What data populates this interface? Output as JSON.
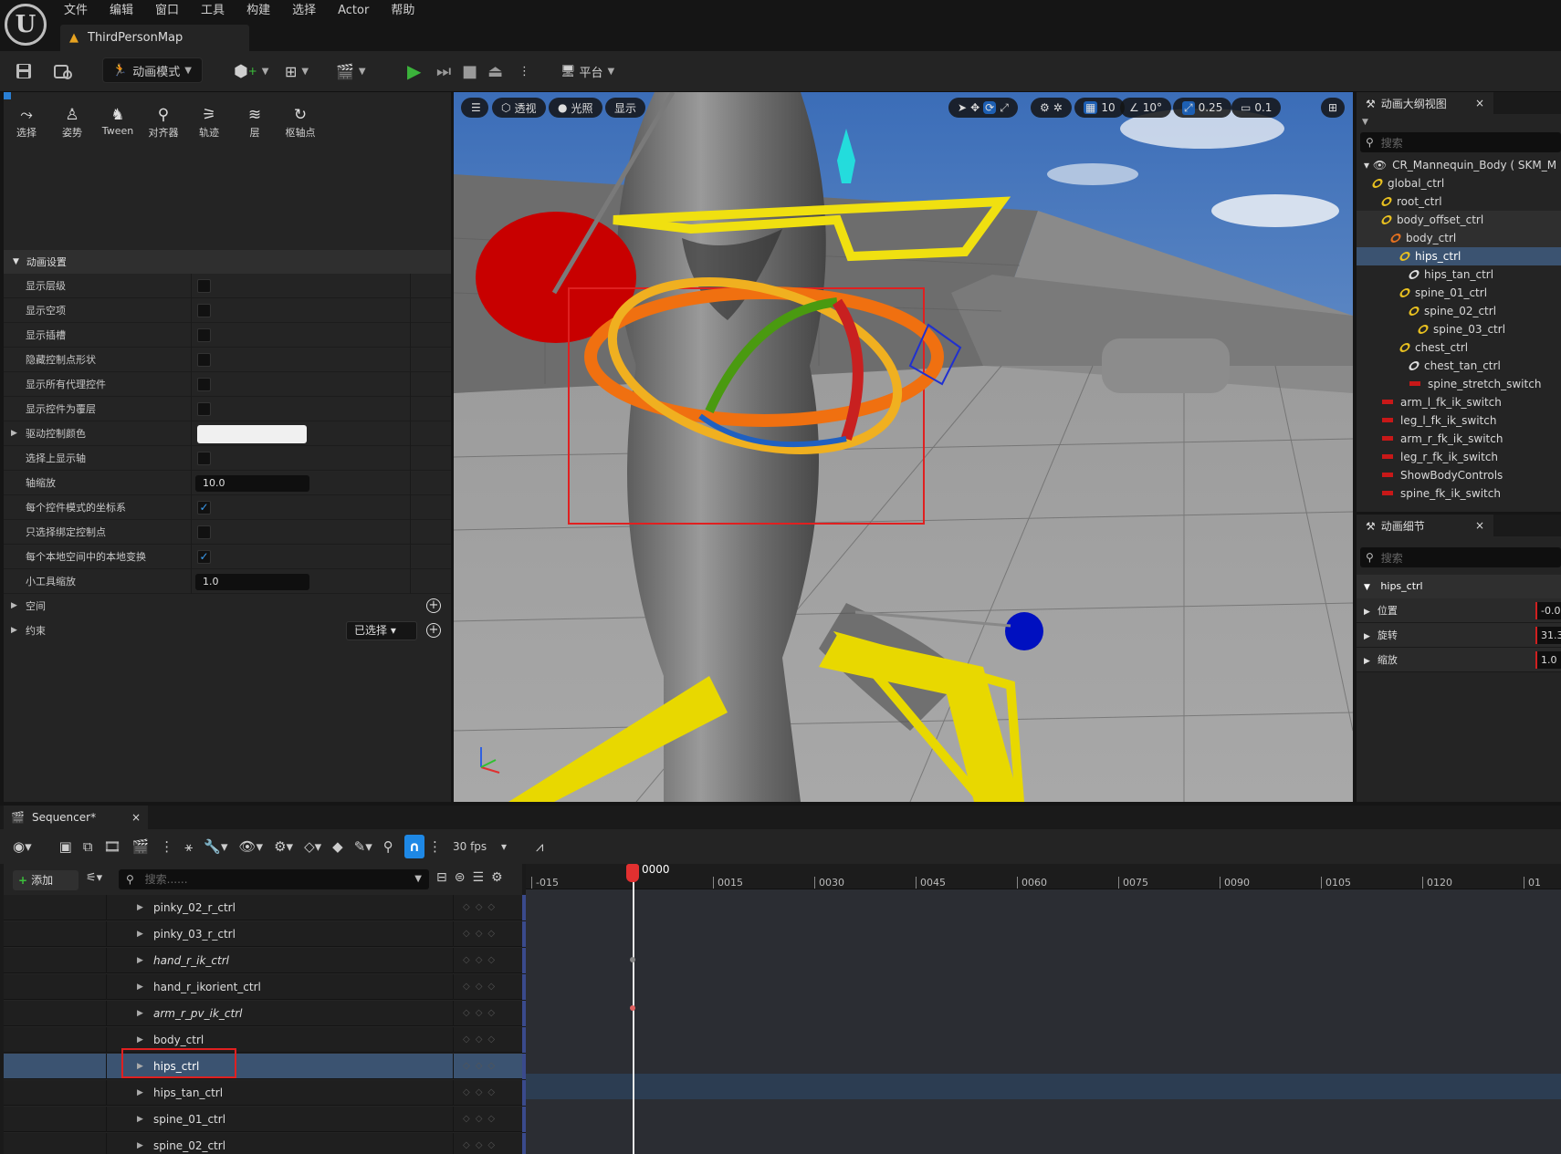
{
  "menubar": {
    "logo_text": "U",
    "items": [
      "文件",
      "编辑",
      "窗口",
      "工具",
      "构建",
      "选择",
      "Actor",
      "帮助"
    ],
    "map_tab": "ThirdPersonMap"
  },
  "toolbar": {
    "mode_label": "动画模式",
    "platform_label": "平台"
  },
  "anim_tools": [
    "选择",
    "姿势",
    "Tween",
    "对齐器",
    "轨迹",
    "层",
    "枢轴点"
  ],
  "anim_settings": {
    "section_title": "动画设置",
    "rows": [
      {
        "label": "显示层级",
        "type": "check",
        "checked": false
      },
      {
        "label": "显示空项",
        "type": "check",
        "checked": false
      },
      {
        "label": "显示插槽",
        "type": "check",
        "checked": false
      },
      {
        "label": "隐藏控制点形状",
        "type": "check",
        "checked": false
      },
      {
        "label": "显示所有代理控件",
        "type": "check",
        "checked": false
      },
      {
        "label": "显示控件为覆层",
        "type": "check",
        "checked": false
      },
      {
        "label": "驱动控制颜色",
        "type": "color",
        "expandable": true
      },
      {
        "label": "选择上显示轴",
        "type": "check",
        "checked": false
      },
      {
        "label": "轴缩放",
        "type": "number",
        "value": "10.0"
      },
      {
        "label": "每个控件模式的坐标系",
        "type": "check",
        "checked": true
      },
      {
        "label": "只选择绑定控制点",
        "type": "check",
        "checked": false
      },
      {
        "label": "每个本地空间中的本地变换",
        "type": "check",
        "checked": true
      },
      {
        "label": "小工具缩放",
        "type": "number",
        "value": "1.0"
      }
    ],
    "space_label": "空间",
    "constraint_label": "约束",
    "constraint_dropdown": "已选择"
  },
  "viewport": {
    "perspective": "透视",
    "lighting": "光照",
    "show": "显示",
    "grid_snap": "10",
    "rot_snap": "10°",
    "scale_snap": "0.25",
    "cam_speed": "0.1"
  },
  "outliner": {
    "title": "动画大纲视图",
    "search_placeholder": "搜索",
    "items": [
      {
        "label": "CR_Mannequin_Body ( SKM_M",
        "indent": 0,
        "icon": "eye"
      },
      {
        "label": "global_ctrl",
        "indent": 1,
        "icon": "ring-yellow"
      },
      {
        "label": "root_ctrl",
        "indent": 2,
        "icon": "ring-yellow"
      },
      {
        "label": "body_offset_ctrl",
        "indent": 2,
        "icon": "ring-yellow"
      },
      {
        "label": "body_ctrl",
        "indent": 3,
        "icon": "ring-orange"
      },
      {
        "label": "hips_ctrl",
        "indent": 4,
        "icon": "ring-yellow",
        "selected": true
      },
      {
        "label": "hips_tan_ctrl",
        "indent": 5,
        "icon": "ring-white"
      },
      {
        "label": "spine_01_ctrl",
        "indent": 4,
        "icon": "ring-yellow"
      },
      {
        "label": "spine_02_ctrl",
        "indent": 5,
        "icon": "ring-yellow"
      },
      {
        "label": "spine_03_ctrl",
        "indent": 6,
        "icon": "ring-yellow"
      },
      {
        "label": "chest_ctrl",
        "indent": 4,
        "icon": "ring-yellow"
      },
      {
        "label": "chest_tan_ctrl",
        "indent": 5,
        "icon": "ring-white"
      },
      {
        "label": "spine_stretch_switch",
        "indent": 5,
        "icon": "red-bar"
      },
      {
        "label": "arm_l_fk_ik_switch",
        "indent": 2,
        "icon": "red-bar"
      },
      {
        "label": "leg_l_fk_ik_switch",
        "indent": 2,
        "icon": "red-bar"
      },
      {
        "label": "arm_r_fk_ik_switch",
        "indent": 2,
        "icon": "red-bar"
      },
      {
        "label": "leg_r_fk_ik_switch",
        "indent": 2,
        "icon": "red-bar"
      },
      {
        "label": "ShowBodyControls",
        "indent": 2,
        "icon": "red-bar"
      },
      {
        "label": "spine_fk_ik_switch",
        "indent": 2,
        "icon": "red-bar"
      }
    ]
  },
  "details": {
    "title": "动画细节",
    "search_placeholder": "搜索",
    "object_name": "hips_ctrl",
    "rows": [
      {
        "label": "位置",
        "value": "-0.0"
      },
      {
        "label": "旋转",
        "value": "31.3"
      },
      {
        "label": "缩放",
        "value": "1.0"
      }
    ]
  },
  "sequencer": {
    "tab_title": "Sequencer*",
    "add_label": "添加",
    "search_placeholder": "搜索......",
    "fps_label": "30 fps",
    "current_frame": "0000",
    "ruler_ticks": [
      "-015",
      "0015",
      "0030",
      "0045",
      "0060",
      "0075",
      "0090",
      "0105",
      "0120",
      "01"
    ],
    "tracks": [
      {
        "label": "pinky_02_r_ctrl",
        "italic": false
      },
      {
        "label": "pinky_03_r_ctrl",
        "italic": false
      },
      {
        "label": "hand_r_ik_ctrl",
        "italic": true
      },
      {
        "label": "hand_r_ikorient_ctrl",
        "italic": false
      },
      {
        "label": "arm_r_pv_ik_ctrl",
        "italic": true
      },
      {
        "label": "body_ctrl",
        "italic": false
      },
      {
        "label": "hips_ctrl",
        "italic": false,
        "selected": true
      },
      {
        "label": "hips_tan_ctrl",
        "italic": false
      },
      {
        "label": "spine_01_ctrl",
        "italic": false
      },
      {
        "label": "spine_02_ctrl",
        "italic": false
      }
    ]
  }
}
